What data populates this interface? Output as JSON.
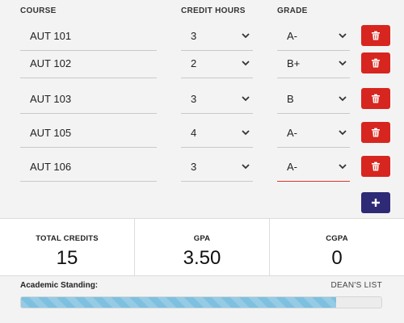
{
  "headers": {
    "course": "COURSE",
    "credit": "CREDIT HOURS",
    "grade": "GRADE"
  },
  "rows": [
    {
      "course": "AUT 101",
      "credit": "3",
      "grade": "A-"
    },
    {
      "course": "AUT 102",
      "credit": "2",
      "grade": "B+"
    },
    {
      "course": "AUT 103",
      "credit": "3",
      "grade": "B"
    },
    {
      "course": "AUT 105",
      "credit": "4",
      "grade": "A-"
    },
    {
      "course": "AUT 106",
      "credit": "3",
      "grade": "A-"
    }
  ],
  "icons": {
    "delete": "trash-icon",
    "add": "plus-icon",
    "dropdown": "chevron-down-icon"
  },
  "stats": {
    "total_credits_label": "TOTAL CREDITS",
    "total_credits_value": "15",
    "gpa_label": "GPA",
    "gpa_value": "3.50",
    "cgpa_label": "CGPA",
    "cgpa_value": "0"
  },
  "standing": {
    "label": "Academic Standing:",
    "value": "DEAN'S LIST",
    "progress_fraction": 0.875
  },
  "colors": {
    "delete": "#d7261f",
    "add": "#2e2a76",
    "active_underline": "#d9352c",
    "progress": "#7ec0df"
  }
}
